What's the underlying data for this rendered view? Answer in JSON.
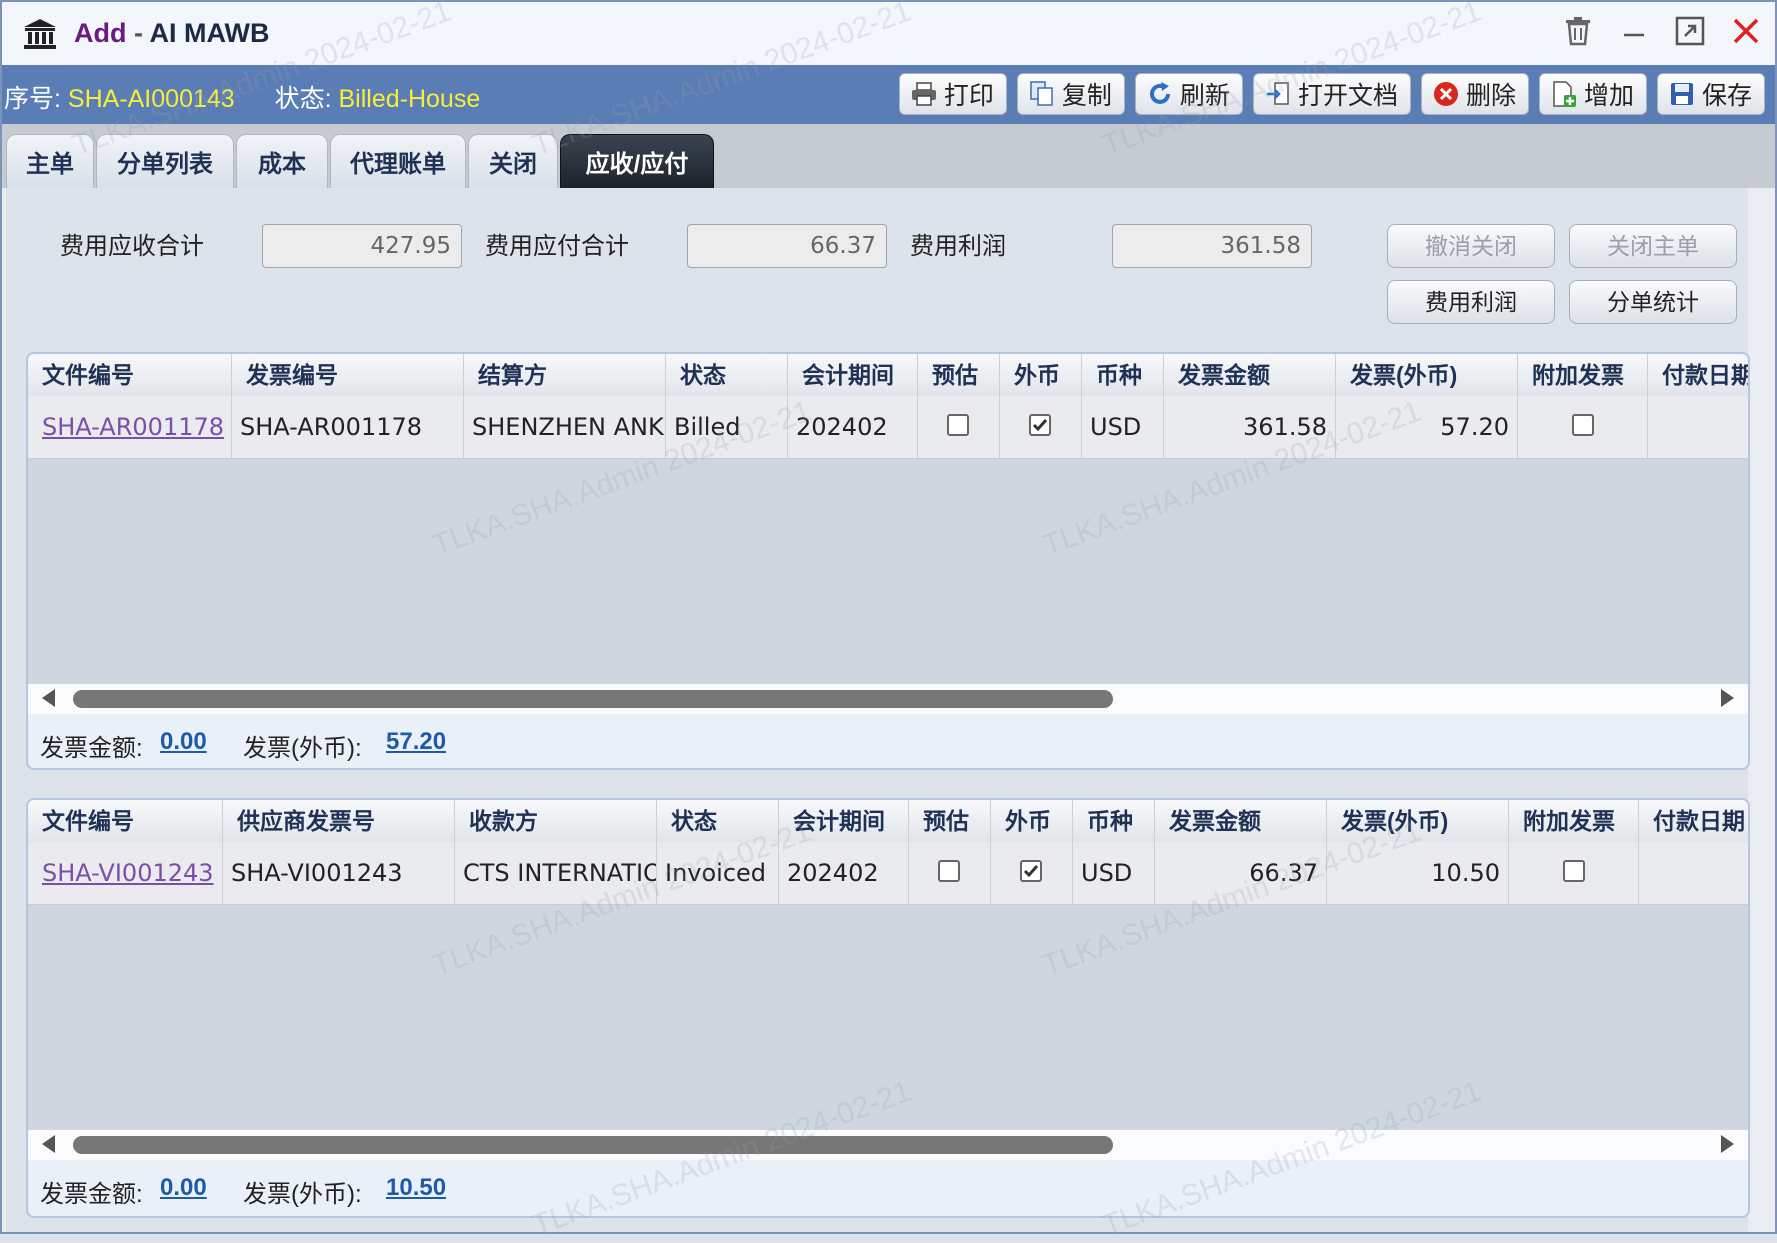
{
  "window": {
    "title_add": "Add",
    "title_sep": " - ",
    "title_name": "AI MAWB"
  },
  "status": {
    "serial_label": "序号:",
    "serial_value": "SHA-AI000143",
    "state_label": "状态:",
    "state_value": "Billed-House"
  },
  "toolbar": {
    "print": "打印",
    "copy": "复制",
    "refresh": "刷新",
    "open_doc": "打开文档",
    "delete": "删除",
    "add": "增加",
    "save": "保存"
  },
  "tabs": [
    "主单",
    "分单列表",
    "成本",
    "代理账单",
    "关闭",
    "应收/应付"
  ],
  "active_tab": "应收/应付",
  "summary": {
    "receivable_label": "费用应收合计",
    "receivable_value": "427.95",
    "payable_label": "费用应付合计",
    "payable_value": "66.37",
    "profit_label": "费用利润",
    "profit_value": "361.58"
  },
  "actions": {
    "cancel_close": "撤消关闭",
    "close_master": "关闭主单",
    "fee_profit": "费用利润",
    "house_stats": "分单统计"
  },
  "ar_grid": {
    "headers": [
      "文件编号",
      "发票编号",
      "结算方",
      "状态",
      "会计期间",
      "预估",
      "外币",
      "币种",
      "发票金额",
      "发票(外币)",
      "附加发票",
      "付款日期"
    ],
    "rows": [
      {
        "file_no": "SHA-AR001178",
        "invoice_no": "SHA-AR001178",
        "party": "SHENZHEN ANKE",
        "status": "Billed",
        "period": "202402",
        "estimate": false,
        "foreign": true,
        "currency": "USD",
        "amount": "361.58",
        "amount_fc": "57.20",
        "extra_invoice": false
      }
    ],
    "footer": {
      "amount_label": "发票金额:",
      "amount_value": "0.00",
      "fc_label": "发票(外币):",
      "fc_value": "57.20"
    }
  },
  "ap_grid": {
    "headers": [
      "文件编号",
      "供应商发票号",
      "收款方",
      "状态",
      "会计期间",
      "预估",
      "外币",
      "币种",
      "发票金额",
      "发票(外币)",
      "附加发票",
      "付款日期"
    ],
    "rows": [
      {
        "file_no": "SHA-VI001243",
        "invoice_no": "SHA-VI001243",
        "party": "CTS INTERNATIO",
        "status": "Invoiced",
        "period": "202402",
        "estimate": false,
        "foreign": true,
        "currency": "USD",
        "amount": "66.37",
        "amount_fc": "10.50",
        "extra_invoice": false
      }
    ],
    "footer": {
      "amount_label": "发票金额:",
      "amount_value": "0.00",
      "fc_label": "发票(外币):",
      "fc_value": "10.50"
    }
  },
  "watermark": "TLKA.SHA.Admin 2024-02-21",
  "colors": {
    "statusbar": "#5b7db5",
    "status_value": "#f7ee3b",
    "title_add": "#6a1b80",
    "link": "#7b4fa8",
    "footer_amount": "#1d5aa8",
    "close_icon": "#e02020"
  },
  "icons": {
    "app": "bank-icon",
    "trash": "trash-icon",
    "minimize": "minimize-icon",
    "maximize": "maximize-icon",
    "close": "close-icon"
  }
}
